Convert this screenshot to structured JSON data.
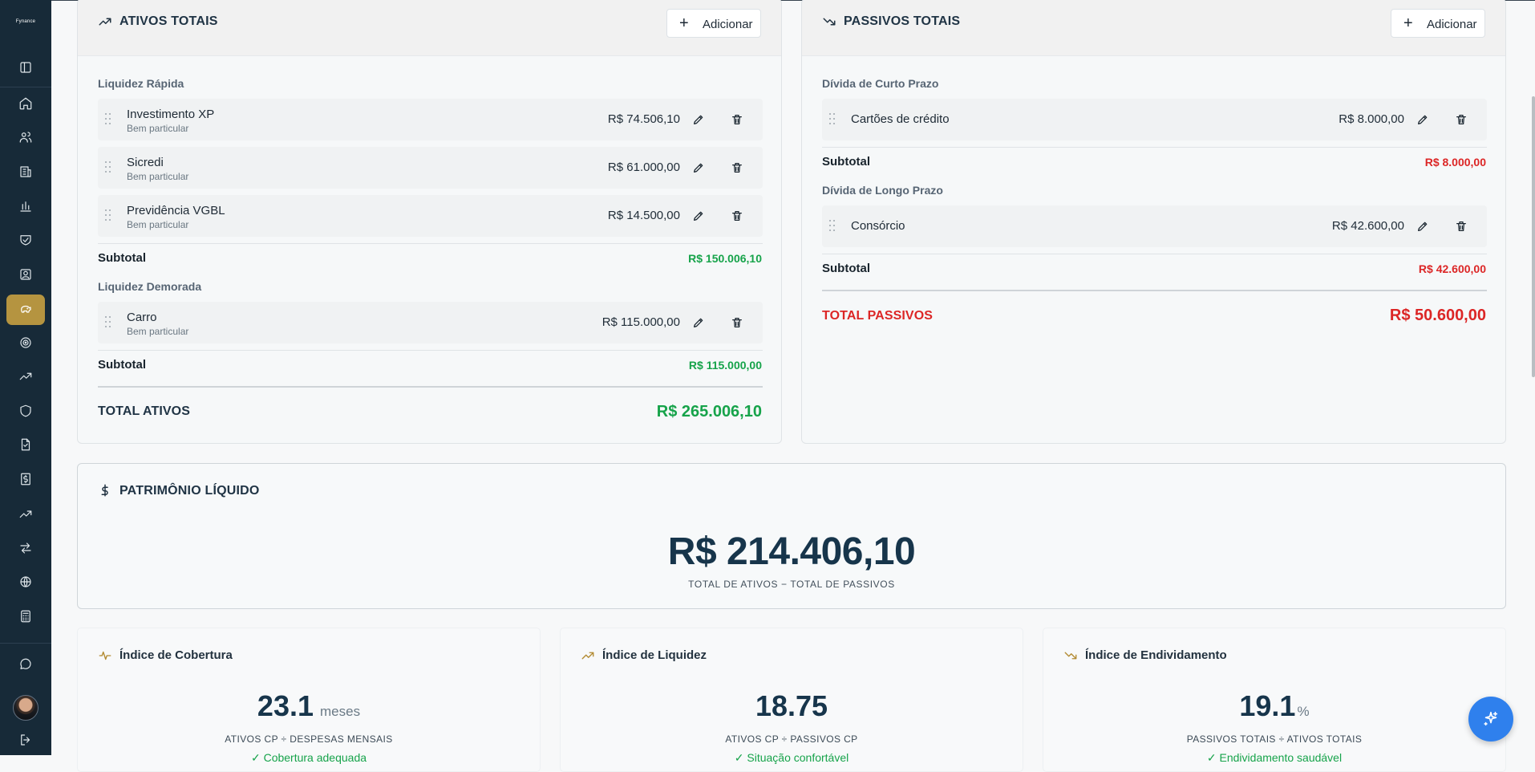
{
  "app": {
    "logo_text": "Fynance"
  },
  "colors": {
    "sidebar": "#172a38",
    "active": "#b59440",
    "positive": "#16a34a",
    "negative": "#dc2626",
    "primary_text": "#17354b",
    "fab": "#2f80ed"
  },
  "sidebar": {
    "items": [
      {
        "icon": "panel-toggle-icon"
      },
      {
        "icon": "home-icon"
      },
      {
        "icon": "users-icon"
      },
      {
        "icon": "building-icon"
      },
      {
        "icon": "bar-chart-icon"
      },
      {
        "icon": "handshake-shield-icon"
      },
      {
        "icon": "contact-card-icon"
      },
      {
        "icon": "piggy-bank-icon",
        "active": true
      },
      {
        "icon": "target-icon"
      },
      {
        "icon": "trending-up-icon"
      },
      {
        "icon": "shield-icon"
      },
      {
        "icon": "document-icon"
      },
      {
        "icon": "money-receipt-icon"
      },
      {
        "icon": "growth-icon"
      },
      {
        "icon": "transfer-icon"
      },
      {
        "icon": "globe-icon"
      },
      {
        "icon": "calculator-icon"
      },
      {
        "icon": "chat-icon"
      },
      {
        "icon": "avatar"
      },
      {
        "icon": "logout-icon"
      }
    ]
  },
  "assets": {
    "title": "ATIVOS TOTAIS",
    "add_label": "Adicionar",
    "groups": [
      {
        "name": "Liquidez Rápida",
        "items": [
          {
            "name": "Investimento XP",
            "note": "Bem particular",
            "amount": "R$ 74.506,10"
          },
          {
            "name": "Sicredi",
            "note": "Bem particular",
            "amount": "R$ 61.000,00"
          },
          {
            "name": "Previdência VGBL",
            "note": "Bem particular",
            "amount": "R$ 14.500,00"
          }
        ],
        "subtotal_label": "Subtotal",
        "subtotal": "R$ 150.006,10"
      },
      {
        "name": "Liquidez Demorada",
        "items": [
          {
            "name": "Carro",
            "note": "Bem particular",
            "amount": "R$ 115.000,00"
          }
        ],
        "subtotal_label": "Subtotal",
        "subtotal": "R$ 115.000,00"
      }
    ],
    "total_label": "TOTAL ATIVOS",
    "total": "R$ 265.006,10"
  },
  "liabilities": {
    "title": "PASSIVOS TOTAIS",
    "add_label": "Adicionar",
    "groups": [
      {
        "name": "Dívida de Curto Prazo",
        "items": [
          {
            "name": "Cartões de crédito",
            "amount": "R$ 8.000,00"
          }
        ],
        "subtotal_label": "Subtotal",
        "subtotal": "R$ 8.000,00"
      },
      {
        "name": "Dívida de Longo Prazo",
        "items": [
          {
            "name": "Consórcio",
            "amount": "R$ 42.600,00"
          }
        ],
        "subtotal_label": "Subtotal",
        "subtotal": "R$ 42.600,00"
      }
    ],
    "total_label": "TOTAL PASSIVOS",
    "total": "R$ 50.600,00"
  },
  "net_worth": {
    "title": "PATRIMÔNIO LÍQUIDO",
    "value": "R$ 214.406,10",
    "subtitle": "TOTAL DE ATIVOS − TOTAL DE PASSIVOS"
  },
  "metrics": [
    {
      "title": "Índice de Cobertura",
      "value": "23.1",
      "unit": "meses",
      "caption": "ATIVOS CP ÷ DESPESAS MENSAIS",
      "status": "✓ Cobertura adequada",
      "icon": "activity-icon"
    },
    {
      "title": "Índice de Liquidez",
      "value": "18.75",
      "unit": "",
      "caption": "ATIVOS CP ÷ PASSIVOS CP",
      "status": "✓ Situação confortável",
      "icon": "trending-up-icon"
    },
    {
      "title": "Índice de Endividamento",
      "value": "19.1",
      "unit": "%",
      "caption": "PASSIVOS TOTAIS ÷ ATIVOS TOTAIS",
      "status": "✓ Endividamento saudável",
      "icon": "trending-down-icon"
    }
  ],
  "fab": {
    "icon": "sparkles-icon"
  }
}
